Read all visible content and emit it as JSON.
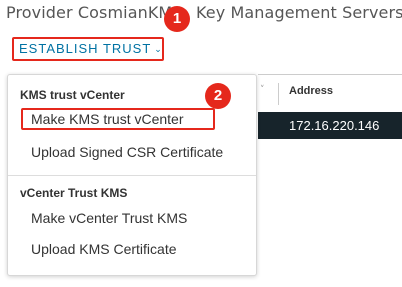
{
  "page": {
    "title_part1": "Provider CosmianKMS",
    "title_part2": "Key Management Servers"
  },
  "toolbar": {
    "establish_trust_label": "ESTABLISH TRUST",
    "chevron": "⌄"
  },
  "callouts": {
    "one": "1",
    "two": "2"
  },
  "grid": {
    "column_address": "Address",
    "sort_caret": "˅",
    "row_address": "172.16.220.146"
  },
  "menu": {
    "section1_header": "KMS trust vCenter",
    "item_make_kms_trust_vcenter": "Make KMS trust vCenter",
    "item_upload_signed_csr": "Upload Signed CSR Certificate",
    "section2_header": "vCenter Trust KMS",
    "item_make_vcenter_trust_kms": "Make vCenter Trust KMS",
    "item_upload_kms_certificate": "Upload KMS Certificate"
  },
  "colors": {
    "accent_red": "#e5281c",
    "link_blue": "#0072a3",
    "selected_row": "#17242b"
  }
}
